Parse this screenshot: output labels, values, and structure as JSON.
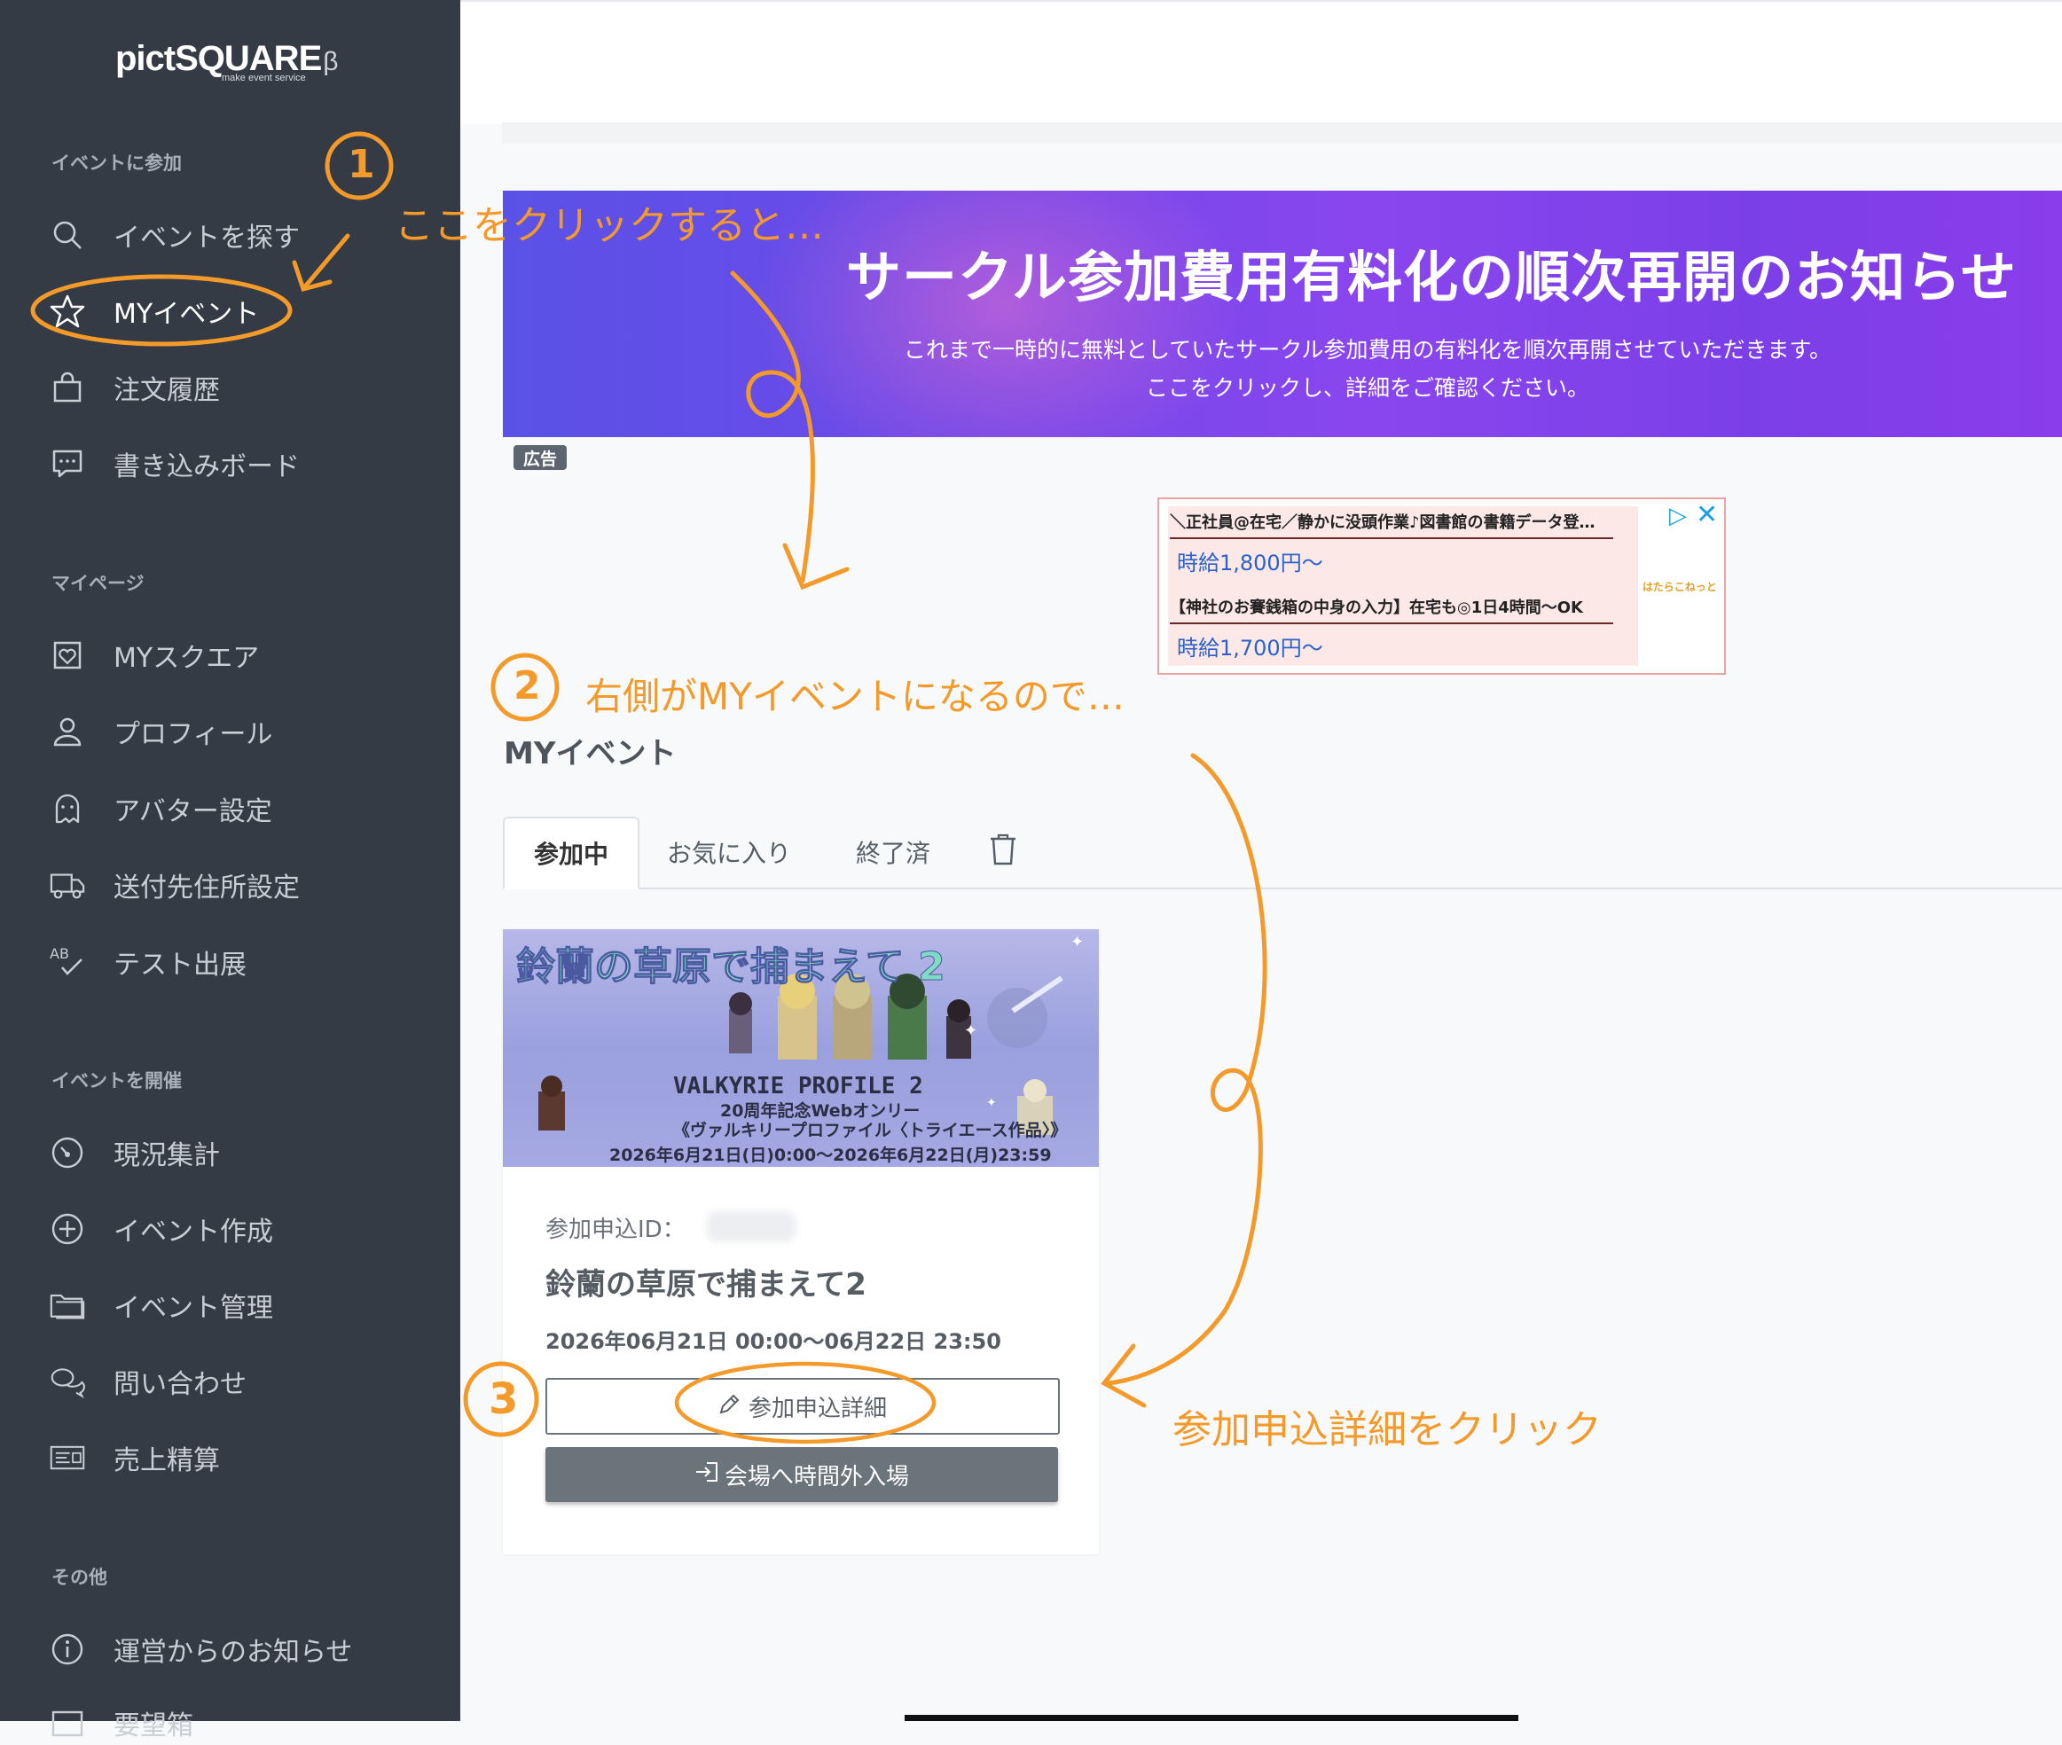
{
  "sidebar": {
    "logo": {
      "main": "pictSQUARE",
      "beta": "β",
      "tagline": "make event service"
    },
    "sections": [
      {
        "heading": "イベントに参加",
        "items": [
          {
            "label": "イベントを探す",
            "icon": "search-icon"
          },
          {
            "label": "MYイベント",
            "icon": "star-icon",
            "active": true
          },
          {
            "label": "注文履歴",
            "icon": "bag-icon"
          },
          {
            "label": "書き込みボード",
            "icon": "chat-icon"
          }
        ]
      },
      {
        "heading": "マイページ",
        "items": [
          {
            "label": "MYスクエア",
            "icon": "heart-frame-icon"
          },
          {
            "label": "プロフィール",
            "icon": "user-icon"
          },
          {
            "label": "アバター設定",
            "icon": "ghost-icon"
          },
          {
            "label": "送付先住所設定",
            "icon": "truck-icon"
          },
          {
            "label": "テスト出展",
            "icon": "ab-check-icon"
          }
        ]
      },
      {
        "heading": "イベントを開催",
        "items": [
          {
            "label": "現況集計",
            "icon": "gauge-icon"
          },
          {
            "label": "イベント作成",
            "icon": "plus-circle-icon"
          },
          {
            "label": "イベント管理",
            "icon": "folder-icon"
          },
          {
            "label": "問い合わせ",
            "icon": "chat-bubbles-icon"
          },
          {
            "label": "売上精算",
            "icon": "receipt-icon"
          }
        ]
      },
      {
        "heading": "その他",
        "items": [
          {
            "label": "運営からのお知らせ",
            "icon": "info-icon"
          },
          {
            "label": "要望箱",
            "icon": "box-icon"
          }
        ]
      }
    ]
  },
  "banner": {
    "title": "サークル参加費用有料化の順次再開のお知らせ",
    "line1": "これまで一時的に無料としていたサークル参加費用の有料化を順次再開させていただきます。",
    "line2": "ここをクリックし、詳細をご確認ください。",
    "ad_label": "広告"
  },
  "ad": {
    "item1_title": "＼正社員@在宅／静かに没頭作業♪図書館の書籍データ登…",
    "item1_price": "時給1,800円〜",
    "item2_title": "【神社のお賽銭箱の中身の入力】在宅も◎1日4時間〜OK",
    "item2_price": "時給1,700円〜",
    "brand": "はたらこねっと"
  },
  "main": {
    "page_title": "MYイベント",
    "tabs": [
      {
        "label": "参加中",
        "active": true
      },
      {
        "label": "お気に入り"
      },
      {
        "label": "終了済"
      }
    ]
  },
  "card": {
    "image": {
      "title": "鈴蘭の草原で捕まえて 2",
      "logo": "VALKYRIE PROFILE 2",
      "line1": "20周年記念Webオンリー",
      "line2": "《ヴァルキリープロファイル〈トライエース作品〉》",
      "line3": "2026年6月21日(日)0:00〜2026年6月22日(月)23:59"
    },
    "id_label": "参加申込ID：",
    "event_name": "鈴蘭の草原で捕まえて2",
    "date": "2026年06月21日 00:00〜06月22日 23:50",
    "detail_button": "参加申込詳細",
    "enter_button": "会場へ時間外入場"
  },
  "annotations": {
    "step1_num": "1",
    "step1_text": "ここをクリックすると…",
    "step2_num": "2",
    "step2_text": "右側がMYイベントになるので…",
    "step3_num": "3",
    "step3_text": "参加申込詳細をクリック",
    "color": "#f39a2a"
  }
}
